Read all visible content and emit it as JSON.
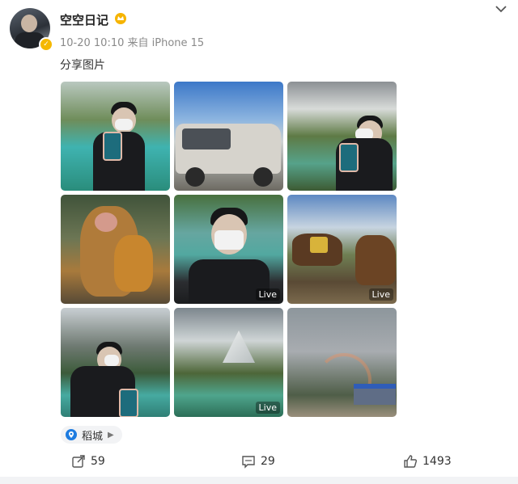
{
  "post": {
    "author": "空空日记",
    "date_time": "10-20 10:10",
    "source": "来自 iPhone 15",
    "text": "分享图片"
  },
  "photos": [
    {
      "subject": "person with mask holding phone by lake",
      "live": ""
    },
    {
      "subject": "silver SUV under blue sky",
      "live": ""
    },
    {
      "subject": "person sitting by mountain lake",
      "live": ""
    },
    {
      "subject": "monkey with baby",
      "live": ""
    },
    {
      "subject": "masked selfie by turquoise lake",
      "live": "Live"
    },
    {
      "subject": "horses on grassland",
      "live": "Live"
    },
    {
      "subject": "person with backpack by lake",
      "live": ""
    },
    {
      "subject": "snowy mountain and green lake",
      "live": "Live"
    },
    {
      "subject": "rainbow over valley and building",
      "live": ""
    }
  ],
  "location": {
    "label": "稻城"
  },
  "actions": {
    "repost_count": "59",
    "comment_count": "29",
    "like_count": "1493"
  },
  "colors": {
    "verified": "#f5b800",
    "location_pin": "#1e7ce0"
  }
}
